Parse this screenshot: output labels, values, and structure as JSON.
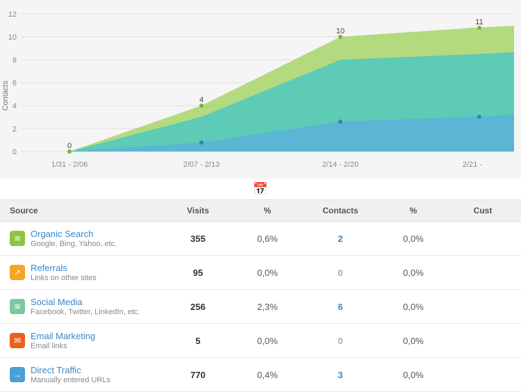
{
  "chart": {
    "y_axis_label": "Contacts",
    "y_ticks": [
      "0",
      "2",
      "4",
      "6",
      "8",
      "10",
      "12"
    ],
    "x_ticks": [
      "1/31 - 2/06",
      "2/07 - 2/13",
      "2/14 - 2/20",
      "2/21 -"
    ],
    "data_labels": [
      "0",
      "4",
      "10",
      "11"
    ]
  },
  "table": {
    "headers": {
      "source": "Source",
      "visits": "Visits",
      "pct1": "%",
      "contacts": "Contacts",
      "pct2": "%",
      "customers": "Cust"
    },
    "rows": [
      {
        "name": "Organic Search",
        "desc": "Google, Bing, Yahoo, etc.",
        "icon_color": "#8dc63f",
        "icon_symbol": "≋",
        "visits": "355",
        "pct1": "0,6%",
        "contacts": "2",
        "contacts_link": true,
        "pct2": "0,0%",
        "customers": ""
      },
      {
        "name": "Referrals",
        "desc": "Links on other sites",
        "icon_color": "#f5a623",
        "icon_symbol": "↗",
        "visits": "95",
        "pct1": "0,0%",
        "contacts": "0",
        "contacts_link": false,
        "pct2": "0,0%",
        "customers": ""
      },
      {
        "name": "Social Media",
        "desc": "Facebook, Twitter, LinkedIn, etc.",
        "icon_color": "#7ec8a0",
        "icon_symbol": "≋",
        "visits": "256",
        "pct1": "2,3%",
        "contacts": "6",
        "contacts_link": true,
        "pct2": "0,0%",
        "customers": ""
      },
      {
        "name": "Email Marketing",
        "desc": "Email links",
        "icon_color": "#e8601c",
        "icon_symbol": "✉",
        "visits": "5",
        "pct1": "0,0%",
        "contacts": "0",
        "contacts_link": false,
        "pct2": "0,0%",
        "customers": ""
      },
      {
        "name": "Direct Traffic",
        "desc": "Manually entered URLs",
        "icon_color": "#4a9fd4",
        "icon_symbol": "→",
        "visits": "770",
        "pct1": "0,4%",
        "contacts": "3",
        "contacts_link": true,
        "pct2": "0,0%",
        "customers": ""
      }
    ]
  }
}
